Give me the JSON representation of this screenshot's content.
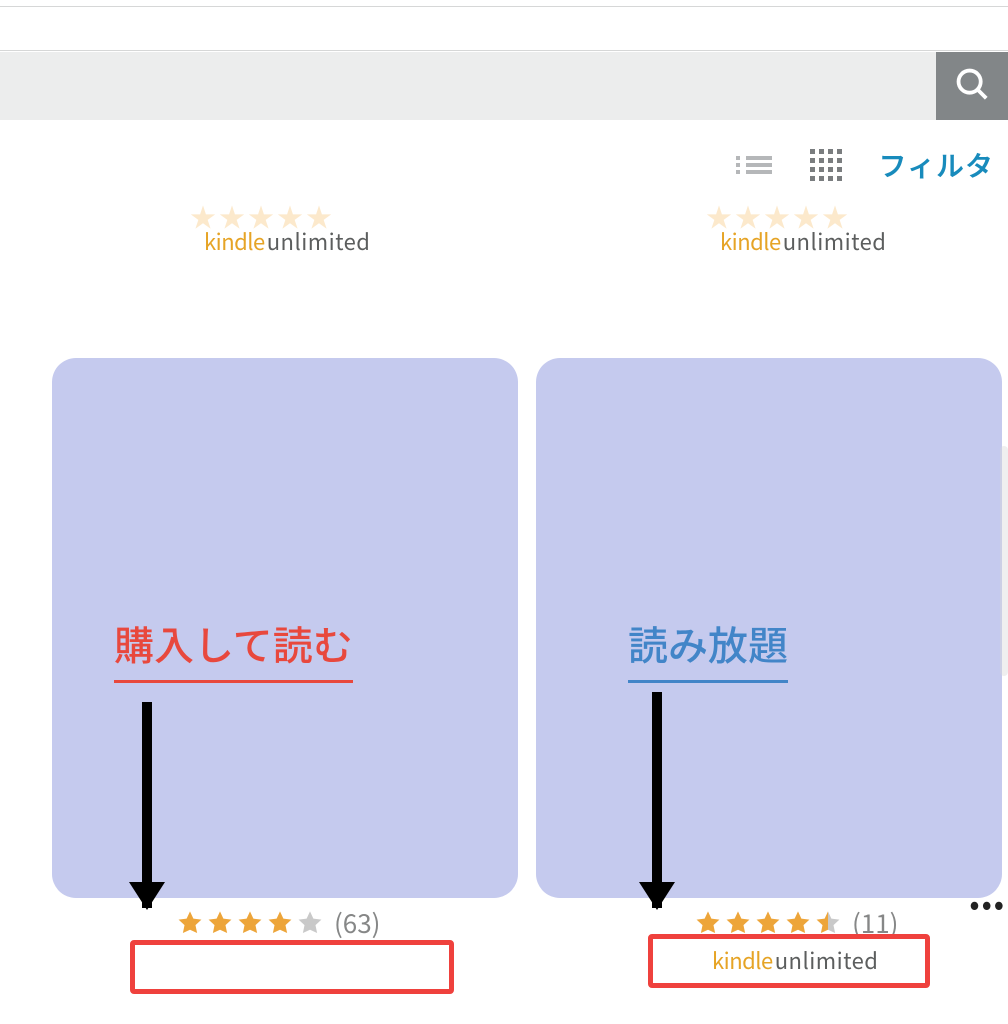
{
  "search": {
    "placeholder": ""
  },
  "toolbar": {
    "filter_label": "フィルタ"
  },
  "ku": {
    "kindle": "kindle",
    "unlimited": "unlimited"
  },
  "upper_items": [
    {
      "stars": "★★★★★",
      "count": ""
    },
    {
      "stars": "★★★★★",
      "count": ""
    }
  ],
  "annotations": {
    "purchase": "購入して読む",
    "unlimited": "読み放題"
  },
  "items": [
    {
      "rating": 4.0,
      "count": "(63)",
      "has_ku": false
    },
    {
      "rating": 4.5,
      "count": "(11)",
      "has_ku": true
    }
  ],
  "more": "•••",
  "colors": {
    "star_fill": "#eda53a",
    "star_empty": "#c9c9c9",
    "accent_red": "#e8483d",
    "accent_blue": "#4285c8",
    "card_bg": "#c5caee"
  }
}
